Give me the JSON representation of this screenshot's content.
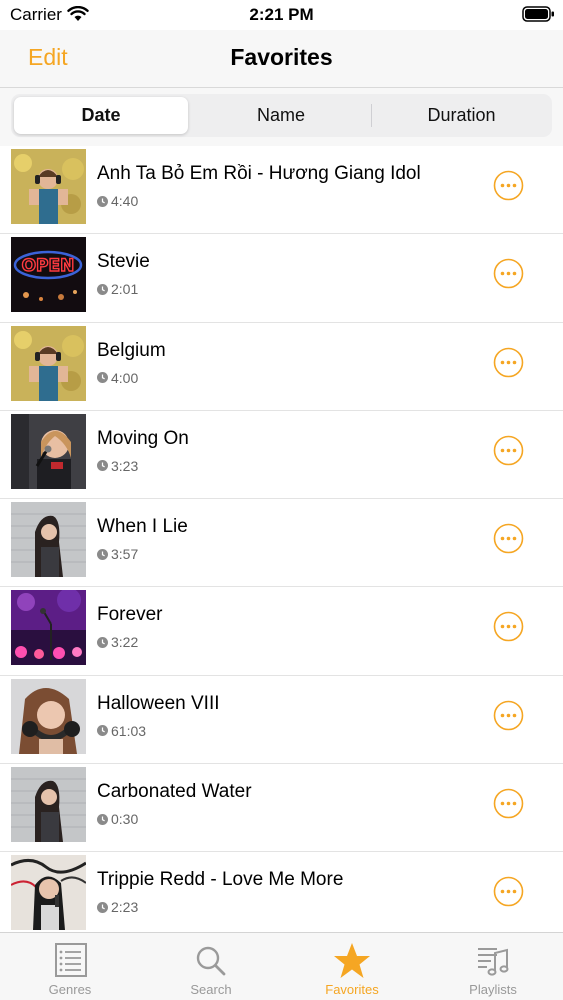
{
  "status_bar": {
    "carrier": "Carrier",
    "time": "2:21 PM"
  },
  "nav": {
    "edit_label": "Edit",
    "title": "Favorites"
  },
  "segments": [
    "Date",
    "Name",
    "Duration"
  ],
  "selected_segment": "Date",
  "tracks": [
    {
      "title": "Anh Ta Bỏ Em Rồi - Hương Giang Idol",
      "duration": "4:40",
      "thumb": "girl-headphones-autumn-photo"
    },
    {
      "title": "Stevie",
      "duration": "2:01",
      "thumb": "neon-open-sign-photo"
    },
    {
      "title": "Belgium",
      "duration": "4:00",
      "thumb": "girl-headphones-autumn-photo"
    },
    {
      "title": "Moving On",
      "duration": "3:23",
      "thumb": "girl-singing-microphone-photo"
    },
    {
      "title": "When I Lie",
      "duration": "3:57",
      "thumb": "woman-brick-wall-photo"
    },
    {
      "title": "Forever",
      "duration": "3:22",
      "thumb": "stage-microphone-lights-photo"
    },
    {
      "title": "Halloween VIII",
      "duration": "61:03",
      "thumb": "woman-headphones-photo"
    },
    {
      "title": "Carbonated Water",
      "duration": "0:30",
      "thumb": "woman-brick-wall-photo"
    },
    {
      "title": "Trippie Redd - Love Me More",
      "duration": "2:23",
      "thumb": "woman-singing-graffiti-photo"
    }
  ],
  "tabs": [
    {
      "label": "Genres",
      "icon": "list-icon"
    },
    {
      "label": "Search",
      "icon": "magnifier-icon"
    },
    {
      "label": "Favorites",
      "icon": "star-icon"
    },
    {
      "label": "Playlists",
      "icon": "music-list-icon"
    }
  ],
  "selected_tab": "Favorites",
  "colors": {
    "accent": "#f5a623",
    "secondary_text": "#666666",
    "inactive_tab": "#999999"
  }
}
